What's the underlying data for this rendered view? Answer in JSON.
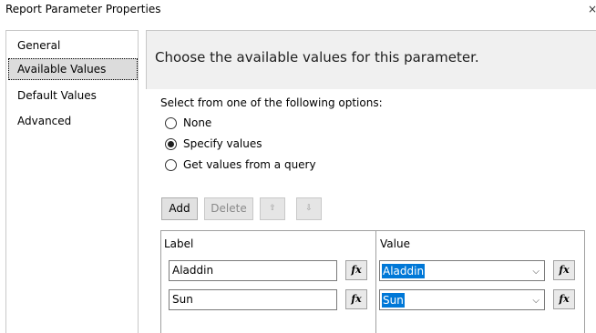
{
  "window": {
    "title": "Report Parameter Properties",
    "close_glyph": "×"
  },
  "nav": {
    "items": [
      {
        "label": "General",
        "selected": false
      },
      {
        "label": "Available Values",
        "selected": true
      },
      {
        "label": "Default Values",
        "selected": false
      },
      {
        "label": "Advanced",
        "selected": false
      }
    ]
  },
  "content": {
    "heading": "Choose the available values for this parameter.",
    "instructions": "Select from one of the following options:",
    "options": [
      {
        "label": "None",
        "checked": false
      },
      {
        "label": "Specify values",
        "checked": true
      },
      {
        "label": "Get values from a query",
        "checked": false
      }
    ],
    "toolbar": {
      "add_label": "Add",
      "delete_label": "Delete",
      "up_glyph": "⇧",
      "down_glyph": "⇩"
    },
    "grid": {
      "label_header": "Label",
      "value_header": "Value",
      "fx_label": "fx",
      "chevron_glyph": "⌵",
      "rows": [
        {
          "label": "Aladdin",
          "value": "Aladdin"
        },
        {
          "label": "Sun",
          "value": "Sun"
        }
      ]
    }
  },
  "colors": {
    "selection_highlight": "#0078d7",
    "nav_selected_bg": "#dcdcdc",
    "header_bg": "#f0f0f0"
  }
}
